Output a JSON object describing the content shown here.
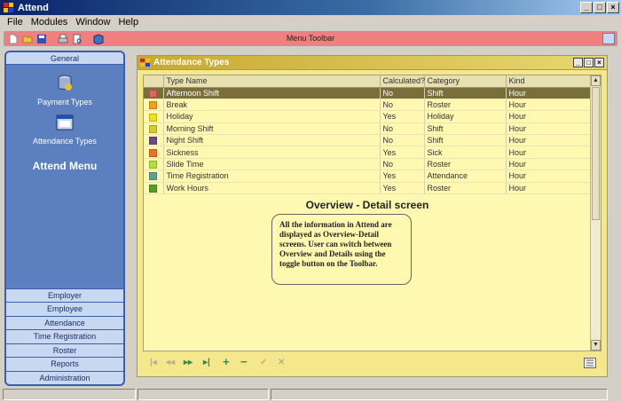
{
  "window": {
    "title": "Attend",
    "minimize": "_",
    "maximize": "□",
    "close": "×"
  },
  "menu": [
    "File",
    "Modules",
    "Window",
    "Help"
  ],
  "toolbar": {
    "title": "Menu Toolbar"
  },
  "sidebar": {
    "header": "General",
    "items": [
      {
        "label": "Payment Types",
        "icon": "database-icon"
      },
      {
        "label": "Attendance Types",
        "icon": "window-icon"
      }
    ],
    "menu_title": "Attend Menu",
    "groups": [
      "Employer",
      "Employee",
      "Attendance",
      "Time Registration",
      "Roster",
      "Reports",
      "Administration"
    ]
  },
  "child": {
    "title": "Attendance Types",
    "columns": [
      "Type Name",
      "Calculated?",
      "Category",
      "Kind"
    ],
    "rows": [
      {
        "color": "#d86a5a",
        "name": "Afternoon Shift",
        "calc": "No",
        "category": "Shift",
        "kind": "Hour"
      },
      {
        "color": "#f0a020",
        "name": "Break",
        "calc": "No",
        "category": "Roster",
        "kind": "Hour"
      },
      {
        "color": "#f0e020",
        "name": "Holiday",
        "calc": "Yes",
        "category": "Holiday",
        "kind": "Hour"
      },
      {
        "color": "#d8c830",
        "name": "Morning Shift",
        "calc": "No",
        "category": "Shift",
        "kind": "Hour"
      },
      {
        "color": "#6a4a8a",
        "name": "Night Shift",
        "calc": "No",
        "category": "Shift",
        "kind": "Hour"
      },
      {
        "color": "#f07020",
        "name": "Sickness",
        "calc": "Yes",
        "category": "Sick",
        "kind": "Hour"
      },
      {
        "color": "#b0e040",
        "name": "Slide Time",
        "calc": "No",
        "category": "Roster",
        "kind": "Hour"
      },
      {
        "color": "#60a090",
        "name": "Time Registration",
        "calc": "Yes",
        "category": "Attendance",
        "kind": "Hour"
      },
      {
        "color": "#5a9a30",
        "name": "Work Hours",
        "calc": "Yes",
        "category": "Roster",
        "kind": "Hour"
      }
    ],
    "overview_title": "Overview - Detail screen",
    "callout": "All the information in Attend are displayed as Overview-Detail screens. User can switch between Overview and Details using the toggle button on the Toolbar."
  },
  "nav": {
    "first": "|◂",
    "prev": "◂◂",
    "next": "▸▸",
    "last": "▸|",
    "add": "+",
    "remove": "−",
    "confirm": "✓",
    "cancel": "✕"
  }
}
